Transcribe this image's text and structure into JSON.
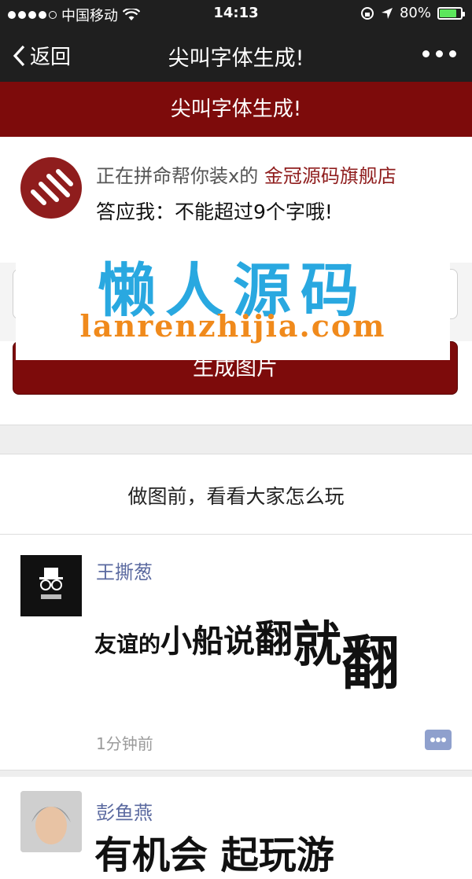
{
  "status_bar": {
    "carrier": "中国移动",
    "time": "14:13",
    "battery": "80%",
    "battery_level": 0.8
  },
  "nav": {
    "back_label": "返回",
    "title": "尖叫字体生成!"
  },
  "banner": {
    "title": "尖叫字体生成!"
  },
  "shop": {
    "line1_prefix": "正在拼命帮你装x的",
    "shop_name": "金冠源码旗舰店",
    "line2": "答应我：不能超过9个字哦!"
  },
  "input": {
    "value": ""
  },
  "generate_button": "生成图片",
  "watermark": {
    "chinese": "懒人源码",
    "url": "lanrenzhijia.com"
  },
  "feed_prompt": "做图前，看看大家怎么玩",
  "posts": [
    {
      "username": "王撕葱",
      "text_parts": [
        "友谊的",
        "小船",
        "说",
        "翻",
        "就",
        "翻"
      ],
      "time": "1分钟前"
    },
    {
      "username": "彭鱼燕",
      "text": "有机会 起玩游"
    }
  ],
  "colors": {
    "dark_bar": "#1f1f1f",
    "brand_red": "#7d0b0b",
    "username": "#5b6aa0",
    "watermark_blue": "#29a8e0",
    "watermark_orange": "#f08a1c"
  }
}
